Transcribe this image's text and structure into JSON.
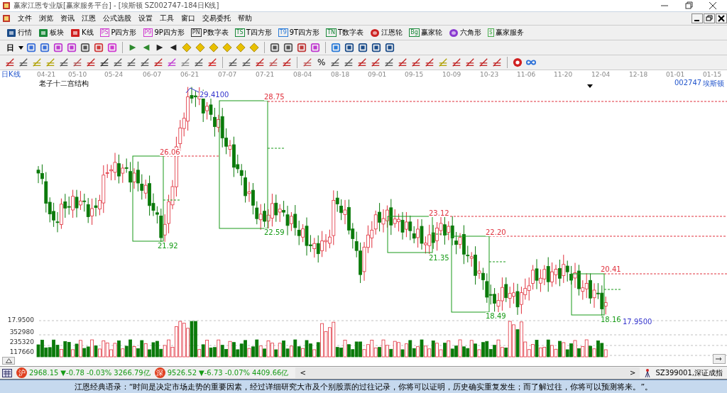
{
  "window": {
    "title": "赢家江恩专业版[赢家服务平台] - [埃斯顿  SZ002747-184日K线]"
  },
  "menu": [
    "文件",
    "浏览",
    "资讯",
    "江恩",
    "公式选股",
    "设置",
    "工具",
    "窗口",
    "交易委托",
    "帮助"
  ],
  "toolbar": [
    {
      "label": "行情"
    },
    {
      "label": "板块"
    },
    {
      "label": "K线"
    },
    {
      "label": "P四方形",
      "icon_text": "PS"
    },
    {
      "label": "9P四方形",
      "icon_text": "P9"
    },
    {
      "label": "P数字表",
      "icon_text": "PN"
    },
    {
      "label": "T四方形",
      "icon_text": "TS"
    },
    {
      "label": "9T四方形",
      "icon_text": "T9"
    },
    {
      "label": "T数字表",
      "icon_text": "TN"
    },
    {
      "label": "江恩轮"
    },
    {
      "label": "赢家轮",
      "icon_text": "Bg"
    },
    {
      "label": "六角形"
    },
    {
      "label": "赢家服务",
      "icon_text": "$"
    }
  ],
  "period_button": "日",
  "percent_button": "%",
  "chart": {
    "period": "日K线",
    "indicator": "老子十二宫结构",
    "code": "002747",
    "name": "埃斯顿",
    "dates": [
      "04-21",
      "05-10",
      "05-24",
      "06-07",
      "06-21",
      "07-07",
      "07-21",
      "08-04",
      "08-18",
      "09-01",
      "09-15",
      "10-09",
      "10-23",
      "11-06",
      "11-20",
      "12-04",
      "12-18",
      "01-01",
      "01-15"
    ],
    "annotations": [
      {
        "text": "29.4100",
        "kind": "extreme"
      },
      {
        "text": "28.75",
        "kind": "high"
      },
      {
        "text": "26.06",
        "kind": "high"
      },
      {
        "text": "21.92",
        "kind": "low"
      },
      {
        "text": "22.59",
        "kind": "low"
      },
      {
        "text": "23.12",
        "kind": "high"
      },
      {
        "text": "21.35",
        "kind": "low"
      },
      {
        "text": "22.20",
        "kind": "high"
      },
      {
        "text": "18.49",
        "kind": "low"
      },
      {
        "text": "20.41",
        "kind": "high"
      },
      {
        "text": "18.16",
        "kind": "low"
      },
      {
        "text": "17.9500",
        "kind": "extreme"
      }
    ],
    "price_tick": "17.9500",
    "volume_ticks": [
      "352980",
      "235320",
      "117660"
    ]
  },
  "status": {
    "indices": [
      {
        "badge": "沪",
        "value": "2968.15",
        "change": "▼-0.78",
        "percent": "-0.03%",
        "amount": "3266.79亿"
      },
      {
        "badge": "深",
        "value": "9526.52",
        "change": "▼-6.73",
        "percent": "-0.07%",
        "amount": "4409.66亿"
      }
    ],
    "scroll_left": "<",
    "scroll_right": ">",
    "index_name": "SZ399001,深证成指"
  },
  "quote": "江恩经典语录：“时间是决定市场走势的重要因素，经过详细研究大市及个别股票的过往记录，你将可以证明，历史确实重复发生；而了解过往，你将可以预测将来。”。"
}
